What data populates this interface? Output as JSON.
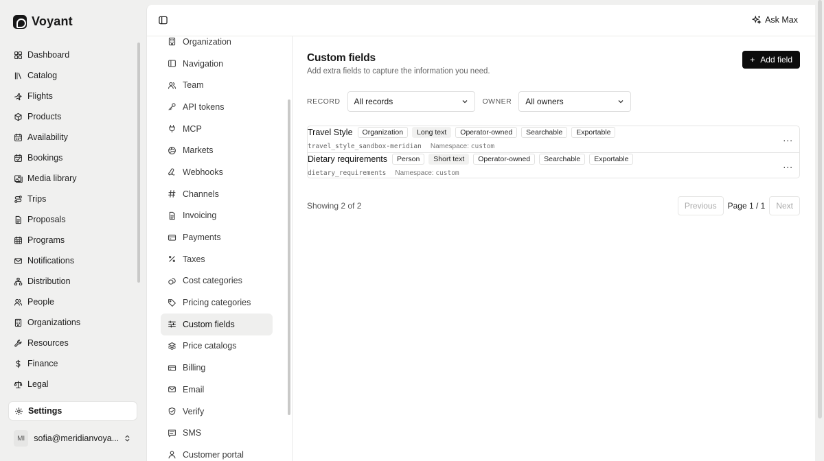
{
  "app": {
    "name": "Voyant"
  },
  "sidebar": {
    "items": [
      {
        "label": "Dashboard",
        "icon": "dashboard-icon"
      },
      {
        "label": "Catalog",
        "icon": "catalog-icon"
      },
      {
        "label": "Flights",
        "icon": "plane-icon"
      },
      {
        "label": "Products",
        "icon": "box-icon"
      },
      {
        "label": "Availability",
        "icon": "calendar-icon"
      },
      {
        "label": "Bookings",
        "icon": "calendar-check-icon"
      },
      {
        "label": "Media library",
        "icon": "image-icon"
      },
      {
        "label": "Trips",
        "icon": "route-icon"
      },
      {
        "label": "Proposals",
        "icon": "document-icon"
      },
      {
        "label": "Programs",
        "icon": "calendar-grid-icon"
      },
      {
        "label": "Notifications",
        "icon": "mail-icon"
      },
      {
        "label": "Distribution",
        "icon": "network-icon"
      },
      {
        "label": "People",
        "icon": "users-icon"
      },
      {
        "label": "Organizations",
        "icon": "building-icon"
      },
      {
        "label": "Resources",
        "icon": "wrench-icon"
      },
      {
        "label": "Finance",
        "icon": "dollar-icon"
      },
      {
        "label": "Legal",
        "icon": "scale-icon"
      }
    ],
    "settings_label": "Settings",
    "user": {
      "initials": "MI",
      "email": "sofia@meridianvoya..."
    }
  },
  "header": {
    "ask_label": "Ask Max"
  },
  "settings_nav": {
    "items": [
      {
        "label": "Organization",
        "icon": "building-icon"
      },
      {
        "label": "Navigation",
        "icon": "panel-icon"
      },
      {
        "label": "Team",
        "icon": "users-icon"
      },
      {
        "label": "API tokens",
        "icon": "key-icon"
      },
      {
        "label": "MCP",
        "icon": "plug-icon"
      },
      {
        "label": "Markets",
        "icon": "globe-icon"
      },
      {
        "label": "Webhooks",
        "icon": "webhook-icon"
      },
      {
        "label": "Channels",
        "icon": "hash-icon"
      },
      {
        "label": "Invoicing",
        "icon": "document-icon"
      },
      {
        "label": "Payments",
        "icon": "card-icon"
      },
      {
        "label": "Taxes",
        "icon": "percent-icon"
      },
      {
        "label": "Cost categories",
        "icon": "coins-icon"
      },
      {
        "label": "Pricing categories",
        "icon": "tag-icon"
      },
      {
        "label": "Custom fields",
        "icon": "sliders-icon",
        "active": true
      },
      {
        "label": "Price catalogs",
        "icon": "layers-icon"
      },
      {
        "label": "Billing",
        "icon": "card-icon"
      },
      {
        "label": "Email",
        "icon": "mail-icon"
      },
      {
        "label": "Verify",
        "icon": "shield-icon"
      },
      {
        "label": "SMS",
        "icon": "message-icon"
      },
      {
        "label": "Customer portal",
        "icon": "user-icon"
      }
    ]
  },
  "page": {
    "title": "Custom fields",
    "subtitle": "Add extra fields to capture the information you need.",
    "add_button": "Add field",
    "filters": {
      "record_label": "RECORD",
      "record_value": "All records",
      "owner_label": "OWNER",
      "owner_value": "All owners"
    },
    "fields": [
      {
        "name": "Travel Style",
        "tags": [
          "Organization",
          "Long text",
          "Operator-owned",
          "Searchable",
          "Exportable"
        ],
        "key": "travel_style_sandbox-meridian",
        "namespace_label": "Namespace:",
        "namespace": "custom"
      },
      {
        "name": "Dietary requirements",
        "tags": [
          "Person",
          "Short text",
          "Operator-owned",
          "Searchable",
          "Exportable"
        ],
        "key": "dietary_requirements",
        "namespace_label": "Namespace:",
        "namespace": "custom"
      }
    ],
    "showing": "Showing 2 of 2",
    "pagination": {
      "previous": "Previous",
      "info": "Page 1 / 1",
      "next": "Next"
    }
  }
}
